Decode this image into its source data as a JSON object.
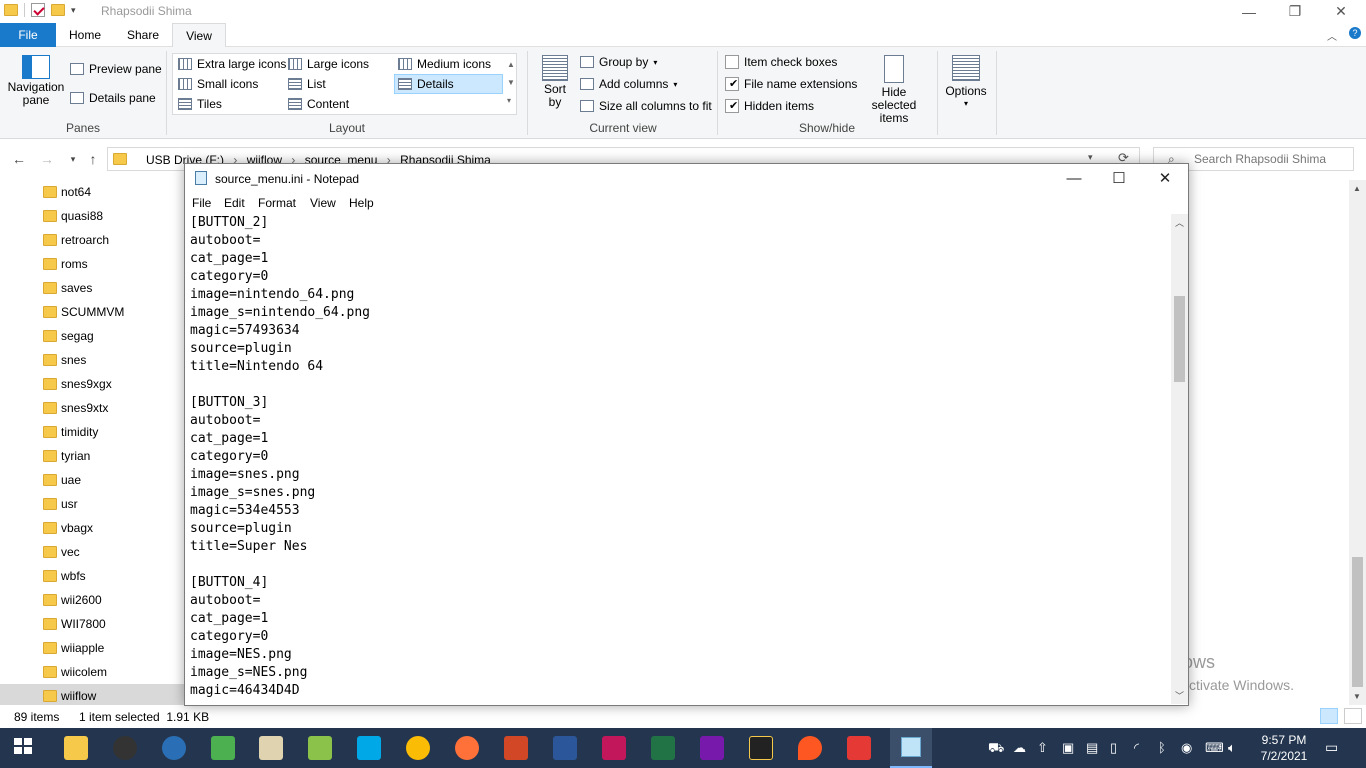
{
  "explorer": {
    "window_title": "Rhapsodii Shima",
    "tabs": {
      "file": "File",
      "home": "Home",
      "share": "Share",
      "view": "View"
    },
    "ribbon": {
      "panes": {
        "navigation_pane": "Navigation pane",
        "preview_pane": "Preview pane",
        "details_pane": "Details pane",
        "label": "Panes"
      },
      "layout": {
        "items": [
          "Extra large icons",
          "Large icons",
          "Medium icons",
          "Small icons",
          "List",
          "Details",
          "Tiles",
          "Content"
        ],
        "selected": "Details",
        "label": "Layout"
      },
      "current_view": {
        "sort_by": "Sort by",
        "group_by": "Group by",
        "add_columns": "Add columns",
        "size_all_columns": "Size all columns to fit",
        "label": "Current view"
      },
      "show_hide": {
        "item_check_boxes": {
          "label": "Item check boxes",
          "checked": false
        },
        "file_name_extensions": {
          "label": "File name extensions",
          "checked": true
        },
        "hidden_items": {
          "label": "Hidden items",
          "checked": true
        },
        "hide_selected": "Hide selected items",
        "label": "Show/hide"
      },
      "options": "Options"
    },
    "breadcrumb": [
      "USB Drive (F:)",
      "wiiflow",
      "source_menu",
      "Rhapsodii Shima"
    ],
    "search_placeholder": "Search Rhapsodii Shima",
    "tree": [
      "not64",
      "quasi88",
      "retroarch",
      "roms",
      "saves",
      "SCUMMVM",
      "segag",
      "snes",
      "snes9xgx",
      "snes9xtx",
      "timidity",
      "tyrian",
      "uae",
      "usr",
      "vbagx",
      "vec",
      "wbfs",
      "wii2600",
      "WII7800",
      "wiiapple",
      "wiicolem",
      "wiiflow"
    ],
    "tree_selected": "wiiflow",
    "status": {
      "items": "89 items",
      "selected": "1 item selected  1.91 KB"
    }
  },
  "notepad": {
    "title": "source_menu.ini - Notepad",
    "menu": [
      "File",
      "Edit",
      "Format",
      "View",
      "Help"
    ],
    "lines": [
      "[BUTTON_2]",
      "autoboot=",
      "cat_page=1",
      "category=0",
      "image=nintendo_64.png",
      "image_s=nintendo_64.png",
      "magic=57493634",
      "source=plugin",
      "title=Nintendo 64",
      "",
      "[BUTTON_3]",
      "autoboot=",
      "cat_page=1",
      "category=0",
      "image=snes.png",
      "image_s=snes.png",
      "magic=534e4553",
      "source=plugin",
      "title=Super Nes",
      "",
      "[BUTTON_4]",
      "autoboot=",
      "cat_page=1",
      "category=0",
      "image=NES.png",
      "image_s=NES.png",
      "magic=46434D4D"
    ]
  },
  "watermark": {
    "line1": "Activate Windows",
    "line2": "Go to Settings to activate Windows."
  },
  "clock": {
    "time": "9:57 PM",
    "date": "7/2/2021"
  }
}
